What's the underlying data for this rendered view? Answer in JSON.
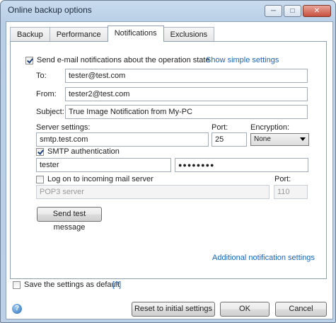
{
  "window": {
    "title": "Online backup options"
  },
  "tabs": [
    {
      "label": "Backup"
    },
    {
      "label": "Performance"
    },
    {
      "label": "Notifications"
    },
    {
      "label": "Exclusions"
    }
  ],
  "notifications": {
    "send_email_label": "Send e-mail notifications about the operation state",
    "show_simple_link": "Show simple settings",
    "to_label": "To:",
    "to_value": "tester@test.com",
    "from_label": "From:",
    "from_value": "tester2@test.com",
    "subject_label": "Subject:",
    "subject_value": "True Image Notification from My-PC",
    "server_settings_label": "Server settings:",
    "server_value": "smtp.test.com",
    "port_label": "Port:",
    "port_value": "25",
    "encryption_label": "Encryption:",
    "encryption_value": "None",
    "smtp_auth_label": "SMTP authentication",
    "username_value": "tester",
    "password_value": "●●●●●●●●",
    "logon_incoming_label": "Log on to incoming mail server",
    "incoming_port_label": "Port:",
    "pop3_placeholder": "POP3 server",
    "pop3_port_value": "110",
    "send_test_button": "Send test message",
    "additional_link": "Additional notification settings"
  },
  "footer": {
    "save_default_label": "Save the settings as default",
    "help_link": "[?]",
    "reset_button": "Reset to initial settings",
    "ok_button": "OK",
    "cancel_button": "Cancel"
  },
  "icons": {
    "help": "help-circle-icon",
    "minimize": "minimize-icon",
    "maximize": "maximize-icon",
    "close": "close-icon"
  }
}
